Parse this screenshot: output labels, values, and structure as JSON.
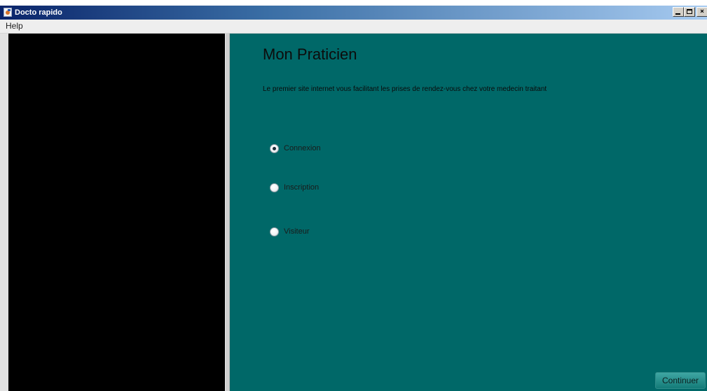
{
  "window": {
    "title": "Docto rapido",
    "icon": "java-cup-icon",
    "controls": [
      "minimize-icon",
      "maximize-icon",
      "close-icon"
    ],
    "title_gradient": [
      "#0a246a",
      "#a6caf0"
    ]
  },
  "menubar": {
    "items": [
      {
        "label": "Help"
      }
    ]
  },
  "main": {
    "heading": "Mon Praticien",
    "tagline": "Le premier site internet vous facilitant les prises de rendez-vous chez votre medecin traitant",
    "options": [
      {
        "label": "Connexion",
        "selected": true
      },
      {
        "label": "Inscription",
        "selected": false
      },
      {
        "label": "Visiteur",
        "selected": false
      }
    ],
    "continue_label": "Continuer"
  },
  "colors": {
    "left_panel": "#000000",
    "right_panel": "#006868",
    "button": "#1f8a87"
  }
}
